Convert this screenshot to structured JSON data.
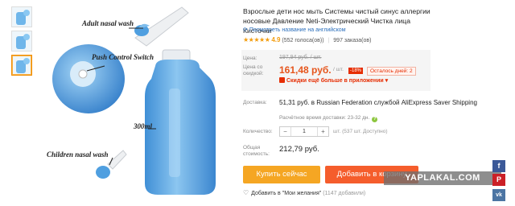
{
  "gallery": {
    "thumbnails": [
      "thumb-1",
      "thumb-2",
      "thumb-3"
    ],
    "active_index": 2,
    "callouts": {
      "adult": "Adult nasal wash",
      "push": "Push Control Switch",
      "volume": "300ml",
      "children": "Children nasal wash"
    }
  },
  "product": {
    "title": "Взрослые дети нос мыть Системы чистый синус аллергии носовые Давление Neti-Электрический Чистка лица Кисточки",
    "translate_link": "Посмотреть название на английском",
    "rating": "4.9",
    "stars": "★★★★★",
    "votes": "(552 голоса(ов))",
    "orders": "997 заказа(ов)"
  },
  "price": {
    "old_label": "Цена:",
    "old_value": "197,94 руб. / шт.",
    "new_label": "Цена со скидкой:",
    "new_value": "161,48 руб.",
    "per_unit": "/ шт.",
    "discount": "-18%",
    "days_left": "Осталось дней: 2",
    "app_promo": "Скидки ещё больше в приложении ▾"
  },
  "shipping": {
    "label": "Доставка:",
    "main": "51,31 руб. в Russian Federation службой AliExpress Saver Shipping",
    "time": "Расчётное время доставки: 23-32 дн."
  },
  "quantity": {
    "label": "Количество:",
    "value": "1",
    "minus": "−",
    "plus": "+",
    "stock": "шт. (537 шт. Доступно)"
  },
  "total": {
    "label": "Общая стоимость:",
    "value": "212,79 руб."
  },
  "actions": {
    "buy_now": "Купить сейчас",
    "add_to_cart": "Добавить в корзину"
  },
  "wishlist": {
    "label": "Добавить в \"Мои желания\"",
    "count": "(1147 добавили)"
  },
  "watermark": "YAPLAKAL.COM",
  "social": {
    "facebook": "f",
    "pinterest": "P",
    "vk": "vk"
  },
  "colors": {
    "accent_price": "#e6551c",
    "buy_button": "#f5a623",
    "cart_button": "#f55d2c",
    "stars": "#f29c0d",
    "link": "#2a6ebb"
  }
}
